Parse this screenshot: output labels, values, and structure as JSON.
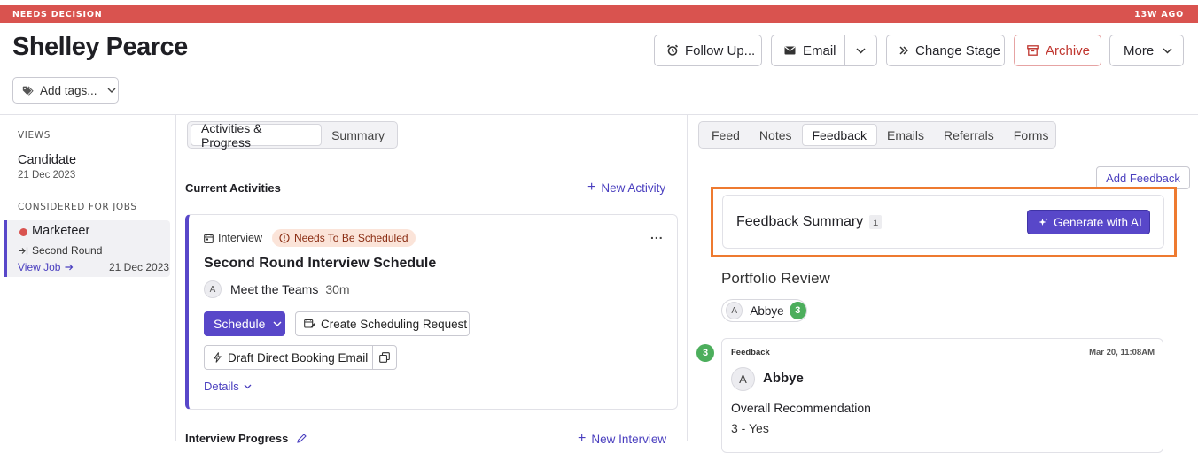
{
  "banner": {
    "status": "NEEDS DECISION",
    "age": "13W AGO"
  },
  "candidate": {
    "name": "Shelley Pearce"
  },
  "header_actions": {
    "follow_up": "Follow Up...",
    "email": "Email",
    "change_stage": "Change Stage",
    "archive": "Archive",
    "more": "More"
  },
  "tags": {
    "placeholder": "Add tags..."
  },
  "sidebar": {
    "views_heading": "VIEWS",
    "candidate_label": "Candidate",
    "candidate_date": "21 Dec 2023",
    "jobs_heading": "CONSIDERED FOR JOBS",
    "job_title": "Marketeer",
    "job_stage": "Second Round",
    "view_job": "View Job",
    "job_date": "21 Dec 2023"
  },
  "middle": {
    "tabs": [
      "Activities & Progress",
      "Summary"
    ],
    "current_activities": "Current Activities",
    "new_activity": "New Activity",
    "activity": {
      "type": "Interview",
      "status": "Needs To Be Scheduled",
      "more": "...",
      "title": "Second Round Interview Schedule",
      "avatar": "A",
      "meeting": "Meet the Teams",
      "duration": "30m",
      "schedule": "Schedule",
      "create_request": "Create Scheduling Request",
      "draft_email": "Draft Direct Booking Email",
      "details": "Details"
    },
    "interview_progress": "Interview Progress",
    "new_interview": "New Interview"
  },
  "right": {
    "tabs": [
      "Feed",
      "Notes",
      "Feedback",
      "Emails",
      "Referrals",
      "Forms"
    ],
    "add_feedback": "Add Feedback",
    "summary_title": "Feedback Summary",
    "info": "i",
    "generate": "Generate with AI",
    "section": "Portfolio Review",
    "chip_avatar": "A",
    "chip_name": "Abbye",
    "chip_score": "3",
    "entry": {
      "score": "3",
      "label": "Feedback",
      "timestamp": "Mar 20, 11:08AM",
      "avatar": "A",
      "author": "Abbye",
      "question": "Overall Recommendation",
      "answer": "3 - Yes"
    }
  },
  "colors": {
    "accent": "#5847c9",
    "banner": "#d9534f",
    "highlight": "#ee7a30",
    "sidebar_active": "#5847c9",
    "score": "#4cae5c"
  }
}
